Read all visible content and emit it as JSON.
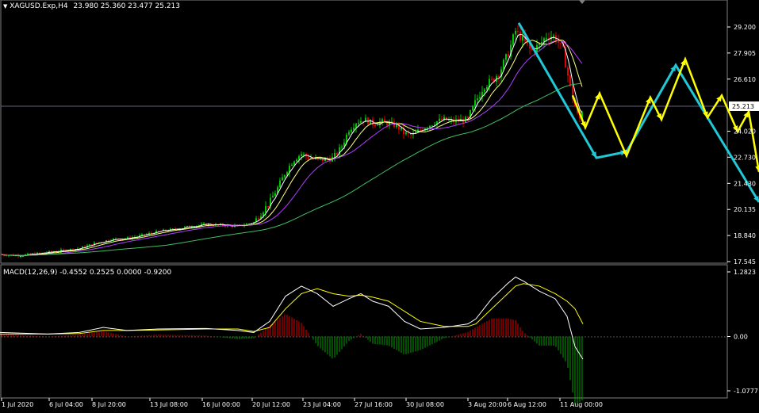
{
  "symbol_header": {
    "icon": "triangle-down-icon",
    "symbol": "XAGUSD.Exp,H4",
    "ohlc": "23.980 25.360 23.477 25.213"
  },
  "macd_header": {
    "text": "MACD(12,26,9) -0.4552 0.2525 0.0000 -0.9200"
  },
  "price_axis": {
    "ticks": [
      "29.200",
      "27.905",
      "26.610",
      "24.020",
      "22.730",
      "21.430",
      "20.135",
      "18.840",
      "17.545"
    ],
    "current": "25.213"
  },
  "macd_axis": {
    "ticks": [
      "1.2823",
      "0.00",
      "-1.0777"
    ]
  },
  "time_axis": {
    "labels": [
      "1 Jul 2020",
      "6 Jul 04:00",
      "8 Jul 20:00",
      "13 Jul 08:00",
      "16 Jul 00:00",
      "20 Jul 12:00",
      "23 Jul 04:00",
      "27 Jul 16:00",
      "30 Jul 08:00",
      "3 Aug 20:00",
      "6 Aug 12:00",
      "11 Aug 00:00"
    ]
  },
  "colors": {
    "background": "#000000",
    "bull_candle": "#00c800",
    "bear_candle": "#e00000",
    "ma_fast": "#ffffff",
    "ma_mid": "#ffff80",
    "ma_slow": "#b040ff",
    "ma_long": "#40c060",
    "projection_yellow": "#ffff00",
    "projection_cyan": "#20c8d8",
    "macd_line": "#ffffff",
    "signal_line": "#ffff00",
    "hist_up": "#e00000",
    "hist_down": "#00a000",
    "axis": "#ffffff"
  },
  "chart_data": [
    {
      "type": "candlestick",
      "title": "XAGUSD.Exp,H4",
      "ylim": [
        17.545,
        29.9
      ],
      "x_labels": [
        "1 Jul 2020",
        "6 Jul 04:00",
        "8 Jul 20:00",
        "13 Jul 08:00",
        "16 Jul 00:00",
        "20 Jul 12:00",
        "23 Jul 04:00",
        "27 Jul 16:00",
        "30 Jul 08:00",
        "3 Aug 20:00",
        "6 Aug 12:00",
        "11 Aug 00:00"
      ],
      "close_path": [
        [
          0,
          17.9
        ],
        [
          20,
          17.85
        ],
        [
          40,
          17.9
        ],
        [
          60,
          18.0
        ],
        [
          80,
          18.1
        ],
        [
          100,
          18.2
        ],
        [
          120,
          18.45
        ],
        [
          140,
          18.65
        ],
        [
          160,
          18.7
        ],
        [
          180,
          18.85
        ],
        [
          200,
          19.05
        ],
        [
          220,
          19.15
        ],
        [
          240,
          19.3
        ],
        [
          260,
          19.4
        ],
        [
          280,
          19.35
        ],
        [
          300,
          19.3
        ],
        [
          320,
          19.5
        ],
        [
          330,
          20.0
        ],
        [
          340,
          20.5
        ],
        [
          350,
          21.2
        ],
        [
          360,
          22.0
        ],
        [
          370,
          22.6
        ],
        [
          380,
          22.9
        ],
        [
          390,
          22.7
        ],
        [
          400,
          22.6
        ],
        [
          410,
          22.6
        ],
        [
          420,
          22.7
        ],
        [
          430,
          23.2
        ],
        [
          440,
          24.1
        ],
        [
          450,
          24.5
        ],
        [
          460,
          24.6
        ],
        [
          470,
          24.4
        ],
        [
          480,
          24.5
        ],
        [
          490,
          24.4
        ],
        [
          500,
          24.3
        ],
        [
          510,
          23.9
        ],
        [
          520,
          23.8
        ],
        [
          530,
          24.1
        ],
        [
          540,
          24.3
        ],
        [
          550,
          24.5
        ],
        [
          560,
          24.6
        ],
        [
          570,
          24.5
        ],
        [
          580,
          24.55
        ],
        [
          590,
          24.6
        ],
        [
          600,
          25.5
        ],
        [
          610,
          26.3
        ],
        [
          620,
          26.5
        ],
        [
          630,
          27.0
        ],
        [
          640,
          27.8
        ],
        [
          650,
          29.0
        ],
        [
          660,
          28.5
        ],
        [
          670,
          28.0
        ],
        [
          680,
          28.3
        ],
        [
          690,
          28.8
        ],
        [
          700,
          28.7
        ],
        [
          710,
          28.0
        ],
        [
          720,
          26.0
        ],
        [
          730,
          24.5
        ],
        [
          735,
          25.2
        ]
      ],
      "projection_yellow": [
        [
          722,
          25.8
        ],
        [
          738,
          24.2
        ],
        [
          756,
          25.9
        ],
        [
          790,
          22.8
        ],
        [
          820,
          25.7
        ],
        [
          834,
          24.6
        ],
        [
          864,
          27.6
        ],
        [
          892,
          24.7
        ],
        [
          910,
          25.8
        ],
        [
          930,
          24.0
        ],
        [
          944,
          25.0
        ],
        [
          957,
          22.0
        ]
      ],
      "projection_cyan": [
        [
          654,
          29.4
        ],
        [
          752,
          22.7
        ],
        [
          790,
          23.0
        ],
        [
          852,
          27.3
        ],
        [
          957,
          20.5
        ]
      ],
      "price_axis_ticks": [
        29.2,
        27.905,
        26.61,
        24.02,
        22.73,
        21.43,
        20.135,
        18.84,
        17.545
      ],
      "current_price": 25.213
    },
    {
      "type": "bar",
      "title": "MACD(12,26,9) -0.4552 0.2525 0.0000 -0.9200",
      "ylim": [
        -1.0777,
        1.2823
      ],
      "macd_path": [
        [
          0,
          0.08
        ],
        [
          60,
          0.05
        ],
        [
          100,
          0.08
        ],
        [
          130,
          0.18
        ],
        [
          160,
          0.12
        ],
        [
          200,
          0.15
        ],
        [
          260,
          0.16
        ],
        [
          300,
          0.12
        ],
        [
          320,
          0.08
        ],
        [
          340,
          0.3
        ],
        [
          360,
          0.8
        ],
        [
          380,
          1.0
        ],
        [
          400,
          0.85
        ],
        [
          420,
          0.6
        ],
        [
          440,
          0.75
        ],
        [
          455,
          0.85
        ],
        [
          470,
          0.7
        ],
        [
          490,
          0.6
        ],
        [
          510,
          0.3
        ],
        [
          530,
          0.15
        ],
        [
          560,
          0.18
        ],
        [
          590,
          0.25
        ],
        [
          600,
          0.35
        ],
        [
          620,
          0.75
        ],
        [
          640,
          1.05
        ],
        [
          650,
          1.18
        ],
        [
          660,
          1.1
        ],
        [
          680,
          0.9
        ],
        [
          700,
          0.75
        ],
        [
          715,
          0.4
        ],
        [
          725,
          -0.2
        ],
        [
          735,
          -0.45
        ]
      ],
      "signal_path": [
        [
          0,
          0.05
        ],
        [
          60,
          0.05
        ],
        [
          100,
          0.06
        ],
        [
          130,
          0.12
        ],
        [
          160,
          0.12
        ],
        [
          200,
          0.13
        ],
        [
          260,
          0.15
        ],
        [
          300,
          0.15
        ],
        [
          320,
          0.1
        ],
        [
          340,
          0.18
        ],
        [
          360,
          0.55
        ],
        [
          380,
          0.85
        ],
        [
          400,
          0.95
        ],
        [
          420,
          0.85
        ],
        [
          440,
          0.8
        ],
        [
          455,
          0.82
        ],
        [
          470,
          0.78
        ],
        [
          490,
          0.7
        ],
        [
          510,
          0.5
        ],
        [
          530,
          0.3
        ],
        [
          560,
          0.2
        ],
        [
          590,
          0.2
        ],
        [
          600,
          0.25
        ],
        [
          620,
          0.55
        ],
        [
          640,
          0.85
        ],
        [
          650,
          1.0
        ],
        [
          660,
          1.05
        ],
        [
          680,
          1.0
        ],
        [
          700,
          0.85
        ],
        [
          715,
          0.7
        ],
        [
          725,
          0.55
        ],
        [
          735,
          0.25
        ]
      ],
      "axis_ticks": [
        1.2823,
        0.0,
        -1.0777
      ]
    }
  ]
}
